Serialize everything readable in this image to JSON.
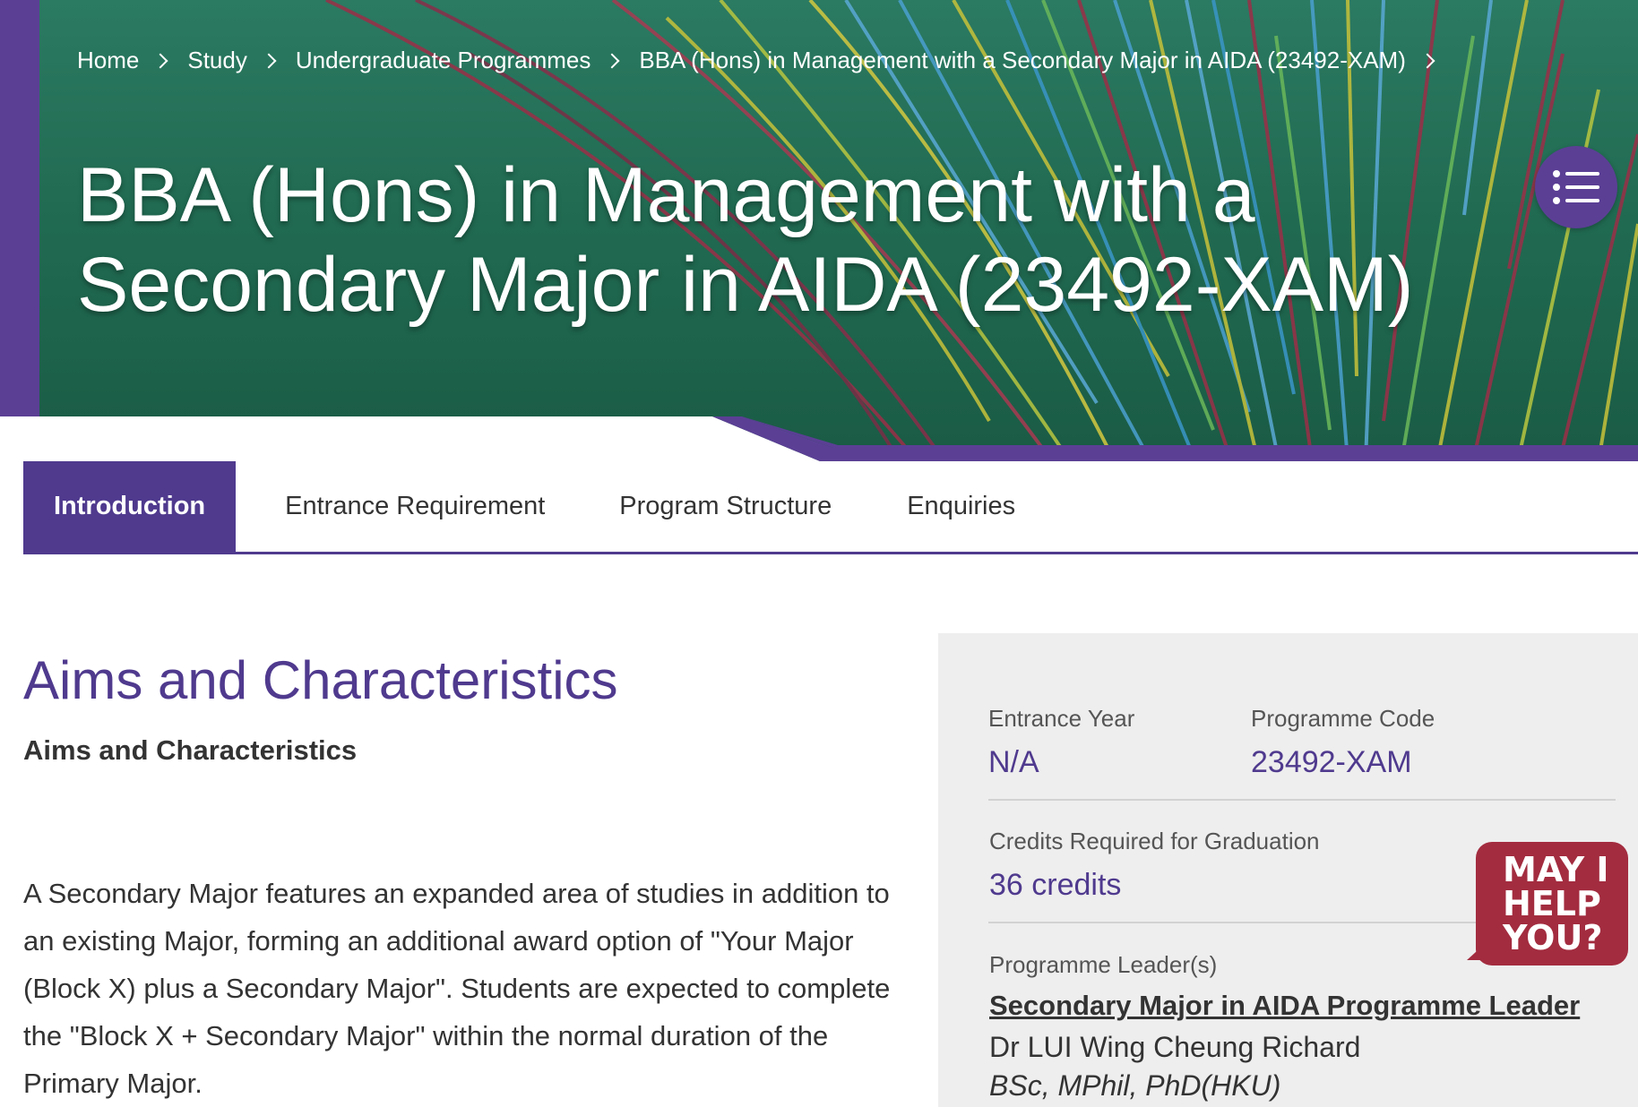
{
  "breadcrumb": {
    "items": [
      "Home",
      "Study",
      "Undergraduate Programmes",
      "BBA (Hons) in Management with a Secondary Major in AIDA (23492-XAM)"
    ]
  },
  "page": {
    "title_line1": "BBA (Hons) in Management with a",
    "title_line2": "Secondary Major in AIDA (23492-XAM)"
  },
  "tabs": [
    {
      "label": "Introduction",
      "active": true
    },
    {
      "label": "Entrance Requirement",
      "active": false
    },
    {
      "label": "Program Structure",
      "active": false
    },
    {
      "label": "Enquiries",
      "active": false
    }
  ],
  "main": {
    "heading": "Aims and Characteristics",
    "subheading": "Aims and Characteristics",
    "body": "A Secondary Major features an expanded area of studies in addition to an existing Major, forming an additional award option of \"Your Major (Block X) plus a Secondary Major\".   Students are expected to complete the \"Block X + Secondary Major\" within the normal duration of the Primary Major."
  },
  "sidebar": {
    "entrance_year_label": "Entrance Year",
    "entrance_year_value": "N/A",
    "programme_code_label": "Programme Code",
    "programme_code_value": "23492-XAM",
    "credits_label": "Credits Required for Graduation",
    "credits_value": "36 credits",
    "leader_label": "Programme Leader(s)",
    "leader_link": "Secondary Major in AIDA Programme Leader",
    "leader_name": "Dr LUI Wing Cheung Richard",
    "leader_quals": "BSc, MPhil, PhD(HKU)"
  },
  "help": {
    "line1": "MAY I",
    "line2": "HELP",
    "line3": "YOU?"
  },
  "colors": {
    "brand_purple": "#4f3a8e",
    "hero_green": "#216b52",
    "help_red": "#a32c3f",
    "sidebar_bg": "#eeeeee"
  },
  "icons": {
    "toc": "list-icon",
    "breadcrumb_separator": "chevron-right-icon"
  }
}
